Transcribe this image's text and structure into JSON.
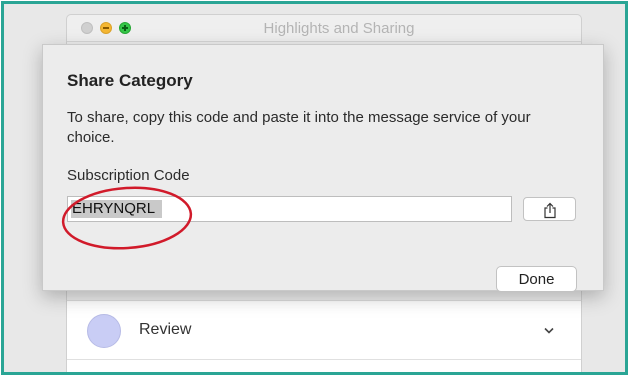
{
  "window": {
    "title": "Highlights and Sharing"
  },
  "background_list": {
    "rows": [
      {
        "label": "Review",
        "icon": "circle-swatch",
        "swatch_color": "#c9cdf5",
        "chevron": "chevron-down-icon"
      }
    ]
  },
  "sheet": {
    "title": "Share Category",
    "description": "To share, copy this code and paste it into the message service of your choice.",
    "field_label": "Subscription Code",
    "code_value": "EHRYNQRL",
    "share_icon": "share-icon",
    "done_label": "Done"
  },
  "annotation": {
    "type": "red-ellipse",
    "color": "#d11a2a"
  },
  "colors": {
    "frame_border": "#2aa595",
    "close": "#d0d0d0",
    "minimize": "#f5b733",
    "maximize": "#35c748"
  }
}
